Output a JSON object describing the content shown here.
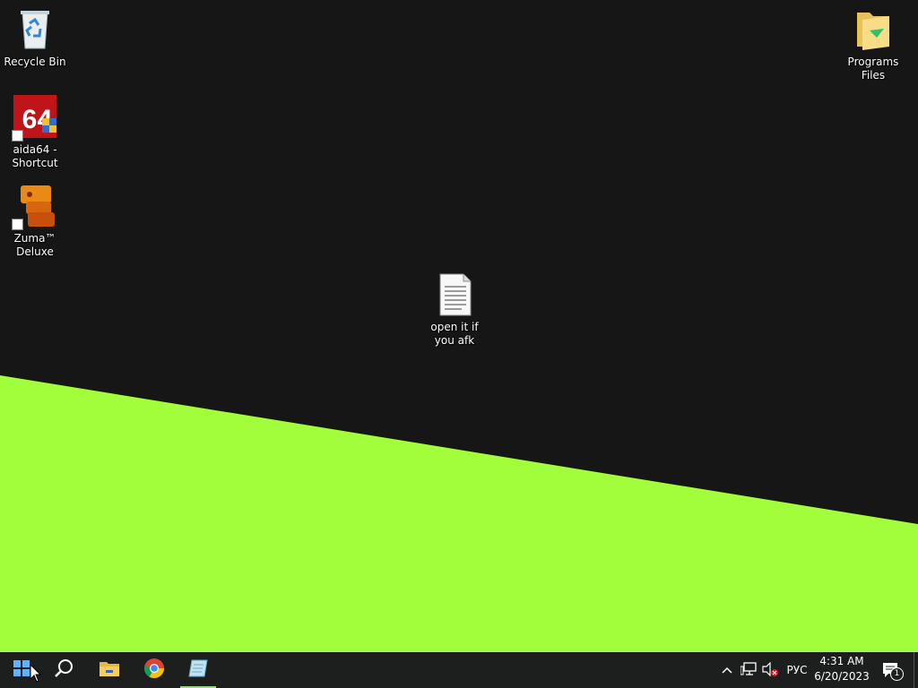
{
  "colors": {
    "desktop_background": "#161616",
    "wallpaper_accent": "#a2fd3a",
    "taskbar_background": "#1c1f1e",
    "active_indicator": "#9ad87a"
  },
  "desktop": {
    "icons": [
      {
        "label": "Recycle Bin",
        "icon": "recycle-bin-icon"
      },
      {
        "label": "aida64 - Shortcut",
        "icon": "aida64-icon"
      },
      {
        "label": "Zuma™ Deluxe",
        "icon": "zuma-icon"
      },
      {
        "label": "open it if you afk",
        "icon": "text-file-icon"
      },
      {
        "label": "Programs Files",
        "icon": "folder-icon"
      }
    ]
  },
  "taskbar": {
    "buttons": [
      {
        "name": "start",
        "icon": "windows-logo-icon"
      },
      {
        "name": "search",
        "icon": "search-icon"
      },
      {
        "name": "file-explorer",
        "icon": "folder-icon"
      },
      {
        "name": "chrome",
        "icon": "chrome-icon"
      },
      {
        "name": "notepad",
        "icon": "notepad-icon",
        "active": true
      }
    ],
    "tray": {
      "chevron": "^",
      "language": "РУС",
      "time": "4:31 AM",
      "date": "6/20/2023",
      "notification_count": "1"
    }
  }
}
